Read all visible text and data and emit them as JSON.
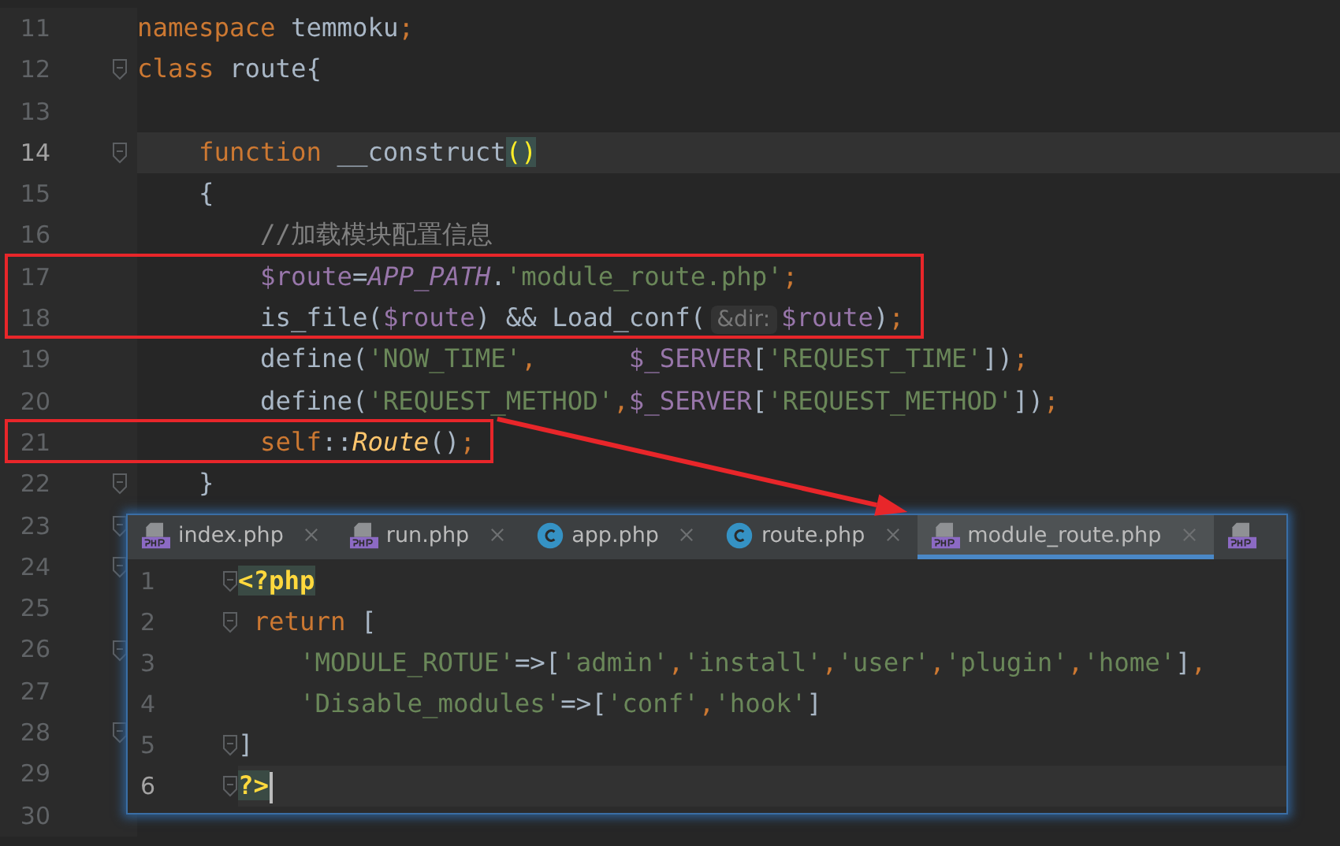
{
  "editor": {
    "lines": [
      {
        "number": "11",
        "segments": [
          {
            "text": "namespace",
            "kind": "kw"
          },
          {
            "text": " temmoku",
            "kind": "plain"
          },
          {
            "text": ";",
            "kind": "kw"
          }
        ]
      },
      {
        "number": "12",
        "fold": true,
        "segments": [
          {
            "text": "class",
            "kind": "kw"
          },
          {
            "text": " route{",
            "kind": "plain"
          }
        ]
      },
      {
        "number": "13"
      },
      {
        "number": "14",
        "fold": true,
        "current": true,
        "segments": [
          {
            "text": "    function",
            "kind": "kw"
          },
          {
            "text": " __construct",
            "kind": "plain"
          },
          {
            "text": "()",
            "kind": "match"
          }
        ]
      },
      {
        "number": "15",
        "segments": [
          {
            "text": "    {",
            "kind": "plain"
          }
        ]
      },
      {
        "number": "16",
        "segments": [
          {
            "text": "        //加载模块配置信息",
            "kind": "comment"
          }
        ]
      },
      {
        "number": "17",
        "marked": true,
        "segments": [
          {
            "text": "        $route",
            "kind": "var"
          },
          {
            "text": "=",
            "kind": "plain"
          },
          {
            "text": "APP_PATH",
            "kind": "const"
          },
          {
            "text": ".",
            "kind": "plain"
          },
          {
            "text": "'module_route.php'",
            "kind": "str"
          },
          {
            "text": ";",
            "kind": "kw"
          }
        ]
      },
      {
        "number": "18",
        "marked": true,
        "segments": [
          {
            "text": "        is_file(",
            "kind": "plain"
          },
          {
            "text": "$route",
            "kind": "var"
          },
          {
            "text": ") && Load_conf(",
            "kind": "plain"
          },
          {
            "text": "&dir:",
            "kind": "hint"
          },
          {
            "text": "$route",
            "kind": "var"
          },
          {
            "text": ")",
            "kind": "plain"
          },
          {
            "text": ";",
            "kind": "kw"
          }
        ]
      },
      {
        "number": "19",
        "segments": [
          {
            "text": "        define(",
            "kind": "plain"
          },
          {
            "text": "'NOW_TIME'",
            "kind": "str"
          },
          {
            "text": ",      ",
            "kind": "kw"
          },
          {
            "text": "$_SERVER",
            "kind": "var"
          },
          {
            "text": "[",
            "kind": "plain"
          },
          {
            "text": "'REQUEST_TIME'",
            "kind": "str"
          },
          {
            "text": "])",
            "kind": "plain"
          },
          {
            "text": ";",
            "kind": "kw"
          }
        ]
      },
      {
        "number": "20",
        "segments": [
          {
            "text": "        define(",
            "kind": "plain"
          },
          {
            "text": "'REQUEST_METHOD'",
            "kind": "str"
          },
          {
            "text": ",",
            "kind": "kw"
          },
          {
            "text": "$_SERVER",
            "kind": "var"
          },
          {
            "text": "[",
            "kind": "plain"
          },
          {
            "text": "'REQUEST_METHOD'",
            "kind": "str"
          },
          {
            "text": "])",
            "kind": "plain"
          },
          {
            "text": ";",
            "kind": "kw"
          }
        ]
      },
      {
        "number": "21",
        "marked": true,
        "segments": [
          {
            "text": "        self",
            "kind": "kw"
          },
          {
            "text": "::",
            "kind": "plain"
          },
          {
            "text": "Route",
            "kind": "fn"
          },
          {
            "text": "()",
            "kind": "plain"
          },
          {
            "text": ";",
            "kind": "kw"
          }
        ]
      },
      {
        "number": "22",
        "fold": true,
        "segments": [
          {
            "text": "    }",
            "kind": "plain"
          }
        ]
      },
      {
        "number": "23",
        "fold": true
      },
      {
        "number": "24",
        "fold": true
      },
      {
        "number": "25"
      },
      {
        "number": "26",
        "fold": true
      },
      {
        "number": "27"
      },
      {
        "number": "28",
        "fold": true
      },
      {
        "number": "29"
      },
      {
        "number": "30"
      }
    ]
  },
  "popup": {
    "tabs": [
      {
        "label": "index.php",
        "kind": "php",
        "selected": false
      },
      {
        "label": "run.php",
        "kind": "php",
        "selected": false
      },
      {
        "label": "app.php",
        "kind": "class",
        "selected": false
      },
      {
        "label": "route.php",
        "kind": "class",
        "selected": false
      },
      {
        "label": "module_route.php",
        "kind": "php",
        "selected": true
      },
      {
        "kind": "php",
        "selected": false
      }
    ],
    "lines": [
      {
        "number": "1",
        "fold": true,
        "segments": [
          {
            "text": "<?php",
            "kind": "tag"
          }
        ]
      },
      {
        "number": "2",
        "fold": true,
        "segments": [
          {
            "text": " return",
            "kind": "kw"
          },
          {
            "text": " [",
            "kind": "plain"
          }
        ]
      },
      {
        "number": "3",
        "segments": [
          {
            "text": "    'MODULE_ROTUE'",
            "kind": "str"
          },
          {
            "text": "=>[",
            "kind": "plain"
          },
          {
            "text": "'admin'",
            "kind": "str"
          },
          {
            "text": ",",
            "kind": "kw"
          },
          {
            "text": "'install'",
            "kind": "str"
          },
          {
            "text": ",",
            "kind": "kw"
          },
          {
            "text": "'user'",
            "kind": "str"
          },
          {
            "text": ",",
            "kind": "kw"
          },
          {
            "text": "'plugin'",
            "kind": "str"
          },
          {
            "text": ",",
            "kind": "kw"
          },
          {
            "text": "'home'",
            "kind": "str"
          },
          {
            "text": "]",
            "kind": "plain"
          },
          {
            "text": ",",
            "kind": "kw"
          }
        ]
      },
      {
        "number": "4",
        "segments": [
          {
            "text": "    'Disable_modules'",
            "kind": "str"
          },
          {
            "text": "=>[",
            "kind": "plain"
          },
          {
            "text": "'conf'",
            "kind": "str"
          },
          {
            "text": ",",
            "kind": "kw"
          },
          {
            "text": "'hook'",
            "kind": "str"
          },
          {
            "text": "]",
            "kind": "plain"
          }
        ]
      },
      {
        "number": "5",
        "fold": true,
        "segments": [
          {
            "text": "]",
            "kind": "plain"
          }
        ]
      },
      {
        "number": "6",
        "fold": true,
        "current": true,
        "segments": [
          {
            "text": "?>",
            "kind": "tag"
          }
        ]
      }
    ]
  }
}
